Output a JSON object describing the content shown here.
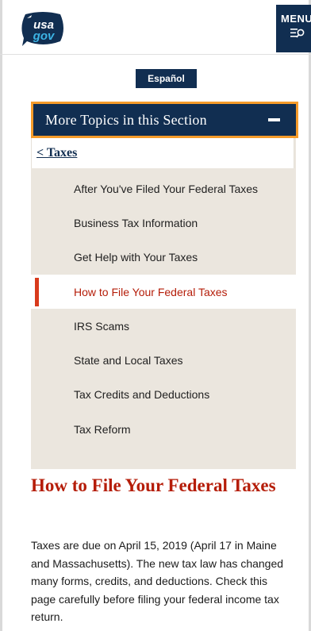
{
  "header": {
    "logo_line1": "usa",
    "logo_line2": "gov",
    "menu_label": "MENU"
  },
  "language_button": "Español",
  "topics": {
    "toggle_title": "More Topics in this Section",
    "back_link": "< Taxes",
    "items": [
      {
        "label": "After You've Filed Your Federal Taxes",
        "active": false
      },
      {
        "label": "Business Tax Information",
        "active": false
      },
      {
        "label": "Get Help with Your Taxes",
        "active": false
      },
      {
        "label": "How to File Your Federal Taxes",
        "active": true
      },
      {
        "label": "IRS Scams",
        "active": false
      },
      {
        "label": "State and Local Taxes",
        "active": false
      },
      {
        "label": "Tax Credits and Deductions",
        "active": false
      },
      {
        "label": "Tax Reform",
        "active": false
      }
    ]
  },
  "main": {
    "title": "How to File Your Federal Taxes",
    "intro": "Taxes are due on April 15, 2019 (April 17 in Maine and Massachusetts). The new tax law has changed many forms, credits, and deductions. Check this page carefully before filing your federal income tax return."
  },
  "colors": {
    "navy": "#112e51",
    "accent_red": "#b51d09",
    "focus_orange": "#f59b2a",
    "panel_bg": "#ebe6de"
  }
}
